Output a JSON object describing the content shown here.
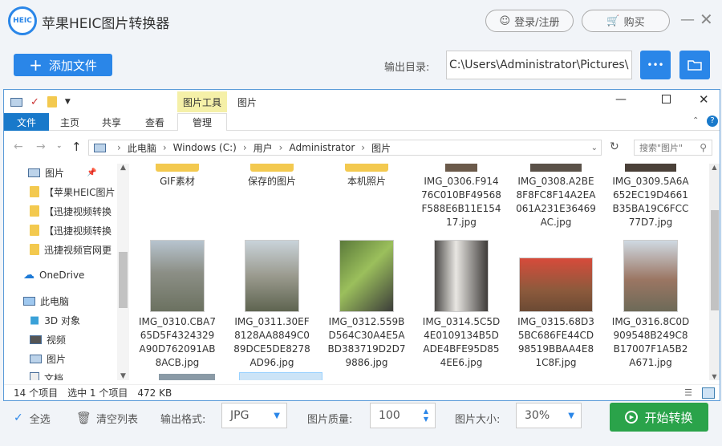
{
  "app": {
    "logo_text": "HEIC",
    "title": "苹果HEIC图片转换器",
    "login_label": "登录/注册",
    "buy_label": "购买",
    "add_file_label": "添加文件",
    "output_dir_label": "输出目录:",
    "output_dir_value": "C:\\Users\\Administrator\\Pictures\\",
    "more_label": "•••"
  },
  "explorer": {
    "context_header": "图片工具",
    "context_name": "图片",
    "tabs": [
      "文件",
      "主页",
      "共享",
      "查看",
      "管理"
    ],
    "breadcrumb": [
      "此电脑",
      "Windows (C:)",
      "用户",
      "Administrator",
      "图片"
    ],
    "search_placeholder": "搜索\"图片\"",
    "nav_items": [
      {
        "label": "图片",
        "icon": "picture-icon"
      },
      {
        "label": "【苹果HEIC图片",
        "icon": "folder-icon"
      },
      {
        "label": "【迅捷视频转换",
        "icon": "folder-icon"
      },
      {
        "label": "【迅捷视频转换",
        "icon": "folder-icon"
      },
      {
        "label": "迅捷视频官网更",
        "icon": "folder-icon"
      },
      {
        "label": "OneDrive",
        "icon": "cloud-icon"
      },
      {
        "label": "此电脑",
        "icon": "computer-icon"
      },
      {
        "label": "3D 对象",
        "icon": "cube-icon"
      },
      {
        "label": "视频",
        "icon": "video-icon"
      },
      {
        "label": "图片",
        "icon": "picture-icon"
      },
      {
        "label": "文档",
        "icon": "document-icon"
      }
    ],
    "row1": [
      {
        "label": "GIF素材"
      },
      {
        "label": "保存的图片"
      },
      {
        "label": "本机照片"
      },
      {
        "label": "IMG_0306.F914\n76C010BF49568\nF588E6B11E154\n17.jpg"
      },
      {
        "label": "IMG_0308.A2BE\n8F8FC8F14A2EA\n061A231E36469\nAC.jpg"
      },
      {
        "label": "IMG_0309.5A6A\n652EC19D4661\nB35BA19C6FCC\n77D7.jpg"
      }
    ],
    "row2": [
      {
        "label": "IMG_0310.CBA7\n65D5F4324329\nA90D762091AB\n8ACB.jpg"
      },
      {
        "label": "IMG_0311.30EF\n8128AA8849C0\n89DCE5DE8278\nAD96.jpg"
      },
      {
        "label": "IMG_0312.559B\nD564C30A4E5A\nBD383719D2D7\n9886.jpg"
      },
      {
        "label": "IMG_0314.5C5D\n4E0109134B5D\nADE4BFE95D85\n4EE6.jpg"
      },
      {
        "label": "IMG_0315.68D3\n5BC686FE44CD\n98519BBAA4E8\n1C8F.jpg"
      },
      {
        "label": "IMG_0316.8C0D\n909548B249C8\nB17007F1A5B2\nA671.jpg"
      }
    ],
    "status_count": "14 个项目",
    "status_selected": "选中 1 个项目",
    "status_size": "472 KB"
  },
  "bottom": {
    "select_all": "全选",
    "clear_list": "清空列表",
    "format_label": "输出格式:",
    "format_value": "JPG",
    "quality_label": "图片质量:",
    "quality_value": "100",
    "size_label": "图片大小:",
    "size_value": "30%",
    "start_label": "开始转换"
  },
  "colors": {
    "accent": "#2a86e8",
    "start": "#2aa34a",
    "ribbon_file": "#1979ca",
    "context_tab": "#f5f0a8"
  }
}
